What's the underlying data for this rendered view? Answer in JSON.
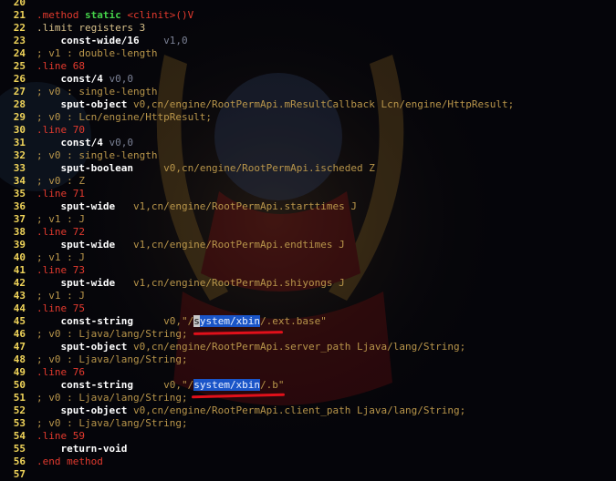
{
  "lines": [
    {
      "n": "20",
      "parts": []
    },
    {
      "n": "21",
      "parts": [
        {
          "t": ".method ",
          "c": "kw"
        },
        {
          "t": "static ",
          "c": "kw2"
        },
        {
          "t": "<clinit>()V",
          "c": "kw"
        }
      ]
    },
    {
      "n": "22",
      "parts": [
        {
          "t": ".limit registers 3",
          "c": "dir"
        }
      ]
    },
    {
      "n": "23",
      "parts": [
        {
          "t": "    const-wide/16",
          "c": "op"
        },
        {
          "t": "    v1,0",
          "c": "reg"
        }
      ]
    },
    {
      "n": "24",
      "parts": [
        {
          "t": "; v1 : double-length",
          "c": "cmt"
        }
      ]
    },
    {
      "n": "25",
      "parts": [
        {
          "t": ".line 68",
          "c": "kw"
        }
      ]
    },
    {
      "n": "26",
      "parts": [
        {
          "t": "    const/4",
          "c": "op"
        },
        {
          "t": " v0,0",
          "c": "reg"
        }
      ]
    },
    {
      "n": "27",
      "parts": [
        {
          "t": "; v0 : single-length",
          "c": "cmt"
        }
      ]
    },
    {
      "n": "28",
      "parts": [
        {
          "t": "    sput-object",
          "c": "op"
        },
        {
          "t": " v0,cn/engine/RootPermApi.mResultCallback Lcn/engine/HttpResult;",
          "c": "cmt"
        }
      ]
    },
    {
      "n": "29",
      "parts": [
        {
          "t": "; v0 : Lcn/engine/HttpResult;",
          "c": "cmt"
        }
      ]
    },
    {
      "n": "30",
      "parts": [
        {
          "t": ".line 70",
          "c": "kw"
        }
      ]
    },
    {
      "n": "31",
      "parts": [
        {
          "t": "    const/4",
          "c": "op"
        },
        {
          "t": " v0,0",
          "c": "reg"
        }
      ]
    },
    {
      "n": "32",
      "parts": [
        {
          "t": "; v0 : single-length",
          "c": "cmt"
        }
      ]
    },
    {
      "n": "33",
      "parts": [
        {
          "t": "    sput-boolean",
          "c": "op"
        },
        {
          "t": "     v0,cn/engine/RootPermApi.ischeded Z",
          "c": "cmt"
        }
      ]
    },
    {
      "n": "34",
      "parts": [
        {
          "t": "; v0 : Z",
          "c": "cmt"
        }
      ]
    },
    {
      "n": "35",
      "parts": [
        {
          "t": ".line 71",
          "c": "kw"
        }
      ]
    },
    {
      "n": "36",
      "parts": [
        {
          "t": "    sput-wide",
          "c": "op"
        },
        {
          "t": "   v1,cn/engine/RootPermApi.starttimes J",
          "c": "cmt"
        }
      ]
    },
    {
      "n": "37",
      "parts": [
        {
          "t": "; v1 : J",
          "c": "cmt"
        }
      ]
    },
    {
      "n": "38",
      "parts": [
        {
          "t": ".line 72",
          "c": "kw"
        }
      ]
    },
    {
      "n": "39",
      "parts": [
        {
          "t": "    sput-wide",
          "c": "op"
        },
        {
          "t": "   v1,cn/engine/RootPermApi.endtimes J",
          "c": "cmt"
        }
      ]
    },
    {
      "n": "40",
      "parts": [
        {
          "t": "; v1 : J",
          "c": "cmt"
        }
      ]
    },
    {
      "n": "41",
      "parts": [
        {
          "t": ".line 73",
          "c": "kw"
        }
      ]
    },
    {
      "n": "42",
      "parts": [
        {
          "t": "    sput-wide",
          "c": "op"
        },
        {
          "t": "   v1,cn/engine/RootPermApi.shiyongs J",
          "c": "cmt"
        }
      ]
    },
    {
      "n": "43",
      "parts": [
        {
          "t": "; v1 : J",
          "c": "cmt"
        }
      ]
    },
    {
      "n": "44",
      "parts": [
        {
          "t": ".line 75",
          "c": "kw"
        }
      ]
    },
    {
      "n": "45",
      "parts": [
        {
          "t": "    const-string",
          "c": "op"
        },
        {
          "t": "     v0,\"/",
          "c": "cmt"
        },
        {
          "t": "s",
          "c": "sel"
        },
        {
          "t": "ystem/xbin",
          "c": "hl"
        },
        {
          "t": "/.ext.base\"",
          "c": "cmt"
        }
      ]
    },
    {
      "n": "46",
      "parts": [
        {
          "t": "; v0 : Ljava/lang/String;",
          "c": "cmt"
        }
      ]
    },
    {
      "n": "47",
      "parts": [
        {
          "t": "    sput-object",
          "c": "op"
        },
        {
          "t": " v0,cn/engine/RootPermApi.server_path Ljava/lang/String;",
          "c": "cmt"
        }
      ]
    },
    {
      "n": "48",
      "parts": [
        {
          "t": "; v0 : Ljava/lang/String;",
          "c": "cmt"
        }
      ]
    },
    {
      "n": "49",
      "parts": [
        {
          "t": ".line 76",
          "c": "kw"
        }
      ]
    },
    {
      "n": "50",
      "parts": [
        {
          "t": "    const-string",
          "c": "op"
        },
        {
          "t": "     v0,\"/",
          "c": "cmt"
        },
        {
          "t": "system/xbin",
          "c": "hl"
        },
        {
          "t": "/.b\"",
          "c": "cmt"
        }
      ]
    },
    {
      "n": "51",
      "parts": [
        {
          "t": "; v0 : Ljava/lang/String;",
          "c": "cmt"
        }
      ]
    },
    {
      "n": "52",
      "parts": [
        {
          "t": "    sput-object",
          "c": "op"
        },
        {
          "t": " v0,cn/engine/RootPermApi.client_path Ljava/lang/String;",
          "c": "cmt"
        }
      ]
    },
    {
      "n": "53",
      "parts": [
        {
          "t": "; v0 : Ljava/lang/String;",
          "c": "cmt"
        }
      ]
    },
    {
      "n": "54",
      "parts": [
        {
          "t": ".line 59",
          "c": "kw"
        }
      ]
    },
    {
      "n": "55",
      "parts": [
        {
          "t": "    return-void",
          "c": "op"
        }
      ]
    },
    {
      "n": "56",
      "parts": [
        {
          "t": ".end method",
          "c": "kw"
        }
      ]
    },
    {
      "n": "57",
      "parts": []
    }
  ],
  "colors": {
    "background": "#05050a",
    "line_number": "#f0d45a",
    "keyword": "#e33a2e",
    "opcode": "#ffffff",
    "comment": "#b8954a",
    "highlight": "#1a55c8",
    "annotation_underline": "#e0101a"
  }
}
